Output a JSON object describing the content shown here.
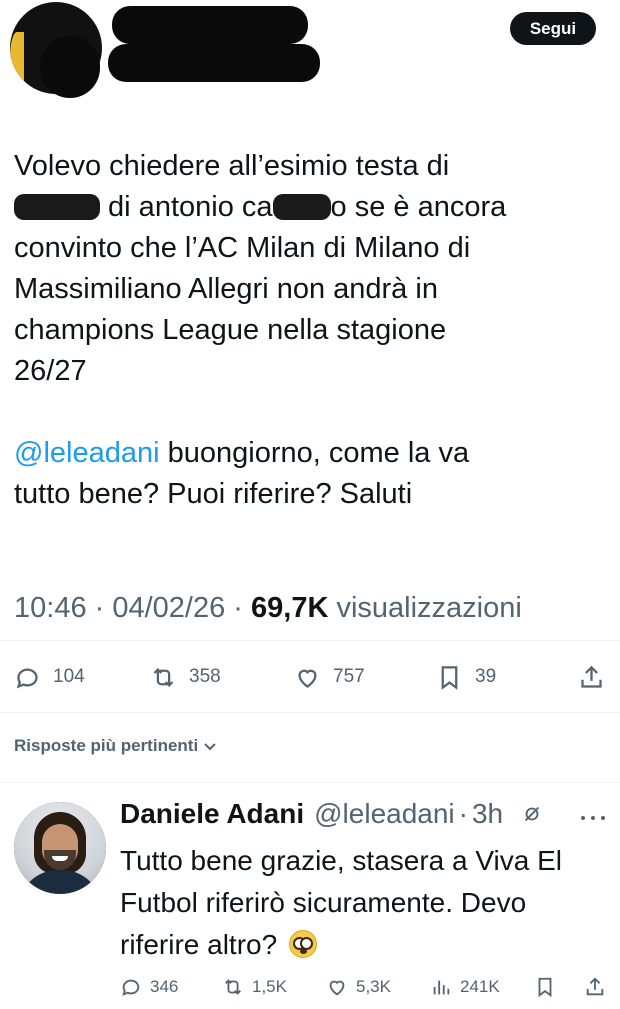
{
  "header": {
    "follow_label": "Segui"
  },
  "tweet": {
    "lines": [
      {
        "text": "Volevo chiedere all’esimio testa di"
      },
      {
        "pre": "",
        "mid": " di antonio ca",
        "post": "o se è ancora"
      },
      {
        "text": "convinto che l’AC Milan di Milano di"
      },
      {
        "text": "Massimiliano Allegri non andrà in"
      },
      {
        "text": "champions League nella stagione"
      },
      {
        "text": "26/27"
      }
    ],
    "mention": "@leleadani",
    "mention_rest": " buongiorno, come la va",
    "last_line": "tutto bene? Puoi riferire? Saluti",
    "time": "10:46 · 04/02/26 · ",
    "views_count": "69,7K",
    "views_label": " visualizzazioni",
    "actions": {
      "replies": "104",
      "retweets": "358",
      "likes": "757",
      "bookmarks": "39"
    }
  },
  "sort_label": "Risposte più pertinenti",
  "reply": {
    "name": "Daniele Adani",
    "handle": "@leleadani",
    "sep": "·",
    "time": "3h",
    "lines": [
      "Tutto bene grazie, stasera a Viva El",
      "Futbol riferirò sicuramente. Devo",
      "riferire altro?"
    ],
    "actions": {
      "replies": "346",
      "retweets": "1,5K",
      "likes": "5,3K",
      "views": "241K"
    }
  },
  "colors": {
    "text": "#0f1419",
    "secondary": "#536471",
    "link": "#1d9bf0",
    "divider": "#eff3f4"
  }
}
